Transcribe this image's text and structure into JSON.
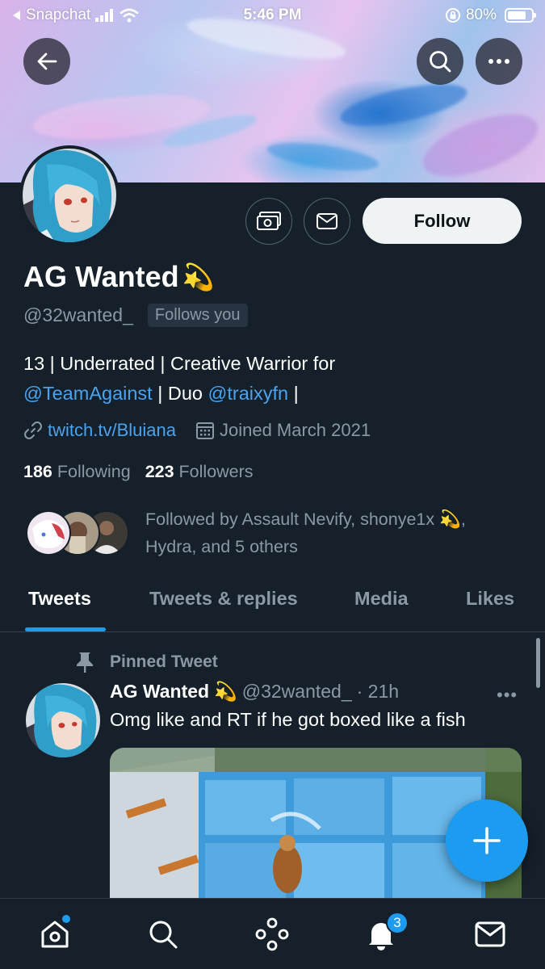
{
  "status_bar": {
    "back_app": "Snapchat",
    "time": "5:46 PM",
    "battery": "80%",
    "battery_level": 0.8
  },
  "header": {
    "back_icon": "arrow-left-icon",
    "search_icon": "search-icon",
    "more_icon": "more-horizontal-icon"
  },
  "profile": {
    "display_name": "AG Wanted",
    "name_emoji": "💫",
    "handle": "@32wanted_",
    "follows_you": "Follows you",
    "follow_label": "Follow",
    "bio": {
      "line1": "13 | Underrated | Creative Warrior for",
      "mention1": "@TeamAgainst",
      "mid": " | Duo ",
      "mention2": "@traixyfn",
      "end": " |"
    },
    "website": "twitch.tv/Bluiana",
    "joined": "Joined March 2021",
    "following_count": "186",
    "following_label": "Following",
    "followers_count": "223",
    "followers_label": "Followers",
    "followed_by": {
      "prefix": "Followed by Assault Nevify, shonye1x ",
      "emoji": "💫",
      "suffix": ",",
      "line2": "Hydra, and 5 others"
    }
  },
  "tabs": [
    {
      "label": "Tweets",
      "active": true
    },
    {
      "label": "Tweets & replies",
      "active": false
    },
    {
      "label": "Media",
      "active": false
    },
    {
      "label": "Likes",
      "active": false
    }
  ],
  "pinned_tweet": {
    "pinned_label": "Pinned Tweet",
    "name": "AG Wanted",
    "emoji": "💫",
    "handle": "@32wanted_",
    "time": "· 21h",
    "more": "•••",
    "text": "Omg like and RT if he got boxed like a fish"
  },
  "bottom_nav": {
    "notifications_badge": "3"
  },
  "colors": {
    "background": "#15202b",
    "accent": "#1d9bf0",
    "secondary_text": "#8b98a5",
    "link": "#4aa3ef"
  }
}
